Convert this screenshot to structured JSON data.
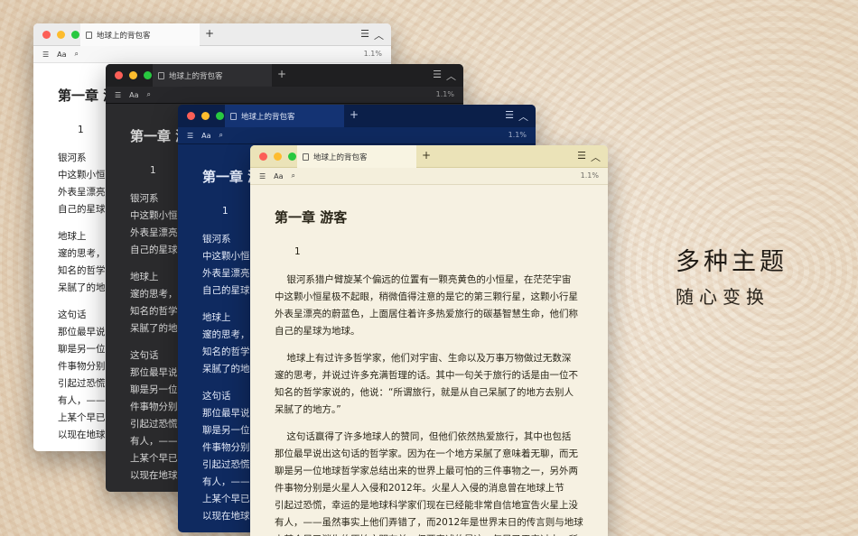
{
  "tagline": {
    "line1": "多种主题",
    "line2": "随心变换"
  },
  "common": {
    "tab_title": "地球上的背包客",
    "plus": "+",
    "menu": "☰",
    "collapse": "︿",
    "list_icon": "☰",
    "font_button": "Aa",
    "search_icon": "⌕",
    "progress": "1.1%",
    "chapter": "第一章 游客",
    "section": "1"
  },
  "white": {
    "chapter": "第一章 游",
    "lines_p1": "银河系\n中这颗小恒\n外表呈漂亮\n自己的星球",
    "lines_p2": "地球上\n邃的思考，\n知名的哲学\n呆腻了的地",
    "lines_p3": "这句话\n那位最早说\n聊是另一位\n件事物分别\n引起过恐慌\n有人，——\n上某个早已\n以现在地球"
  },
  "dark": {
    "chapter": "第一章 游",
    "lines_p1": "银河系\n中这颗小恒\n外表呈漂亮\n自己的星球",
    "lines_p2": "地球上\n邃的思考，\n知名的哲学\n呆腻了的地",
    "lines_p3": "这句话\n那位最早说\n聊是另一位\n件事物分别\n引起过恐慌\n有人，——\n上某个早已\n以现在地球"
  },
  "blue": {
    "chapter": "第一章 游",
    "lines_p1": "银河系\n中这颗小恒\n外表呈漂亮\n自己的星球",
    "lines_p2": "地球上\n邃的思考，\n知名的哲学\n呆腻了的地",
    "lines_p3": "这句话\n那位最早说\n聊是另一位\n件事物分别\n引起过恐慌\n有人，——\n上某个早已\n以现在地球"
  },
  "cream": {
    "p1": "    银河系猎户臂旋某个偏远的位置有一颗亮黄色的小恒星，在茫茫宇宙\n中这颗小恒星极不起眼，稍微值得注意的是它的第三颗行星，这颗小行星\n外表呈漂亮的蔚蓝色，上面居住着许多热爱旅行的碳基智慧生命，他们称\n自己的星球为地球。",
    "p2": "    地球上有过许多哲学家，他们对宇宙、生命以及万事万物做过无数深\n邃的思考，并说过许多充满哲理的话。其中一句关于旅行的话是由一位不\n知名的哲学家说的，他说：“所谓旅行，就是从自己呆腻了的地方去别人\n呆腻了的地方。”",
    "p3": "    这句话赢得了许多地球人的赞同，但他们依然热爱旅行，其中也包括\n那位最早说出这句话的哲学家。因为在一个地方呆腻了意味着无聊，而无\n聊是另一位地球哲学家总结出来的世界上最可怕的三件事物之一，另外两\n件事物分别是火星人入侵和2012年。火星人入侵的消息曾在地球上节\n引起过恐慌，幸运的是地球科学家们现在已经能非常自信地宣告火星上没\n有人，——虽然事实上他们弄错了，而2012年是世界末日的传言则与地球\n上某个早已消失的原始文明有关，但要表述的是这一年早已平安过去，所"
  }
}
